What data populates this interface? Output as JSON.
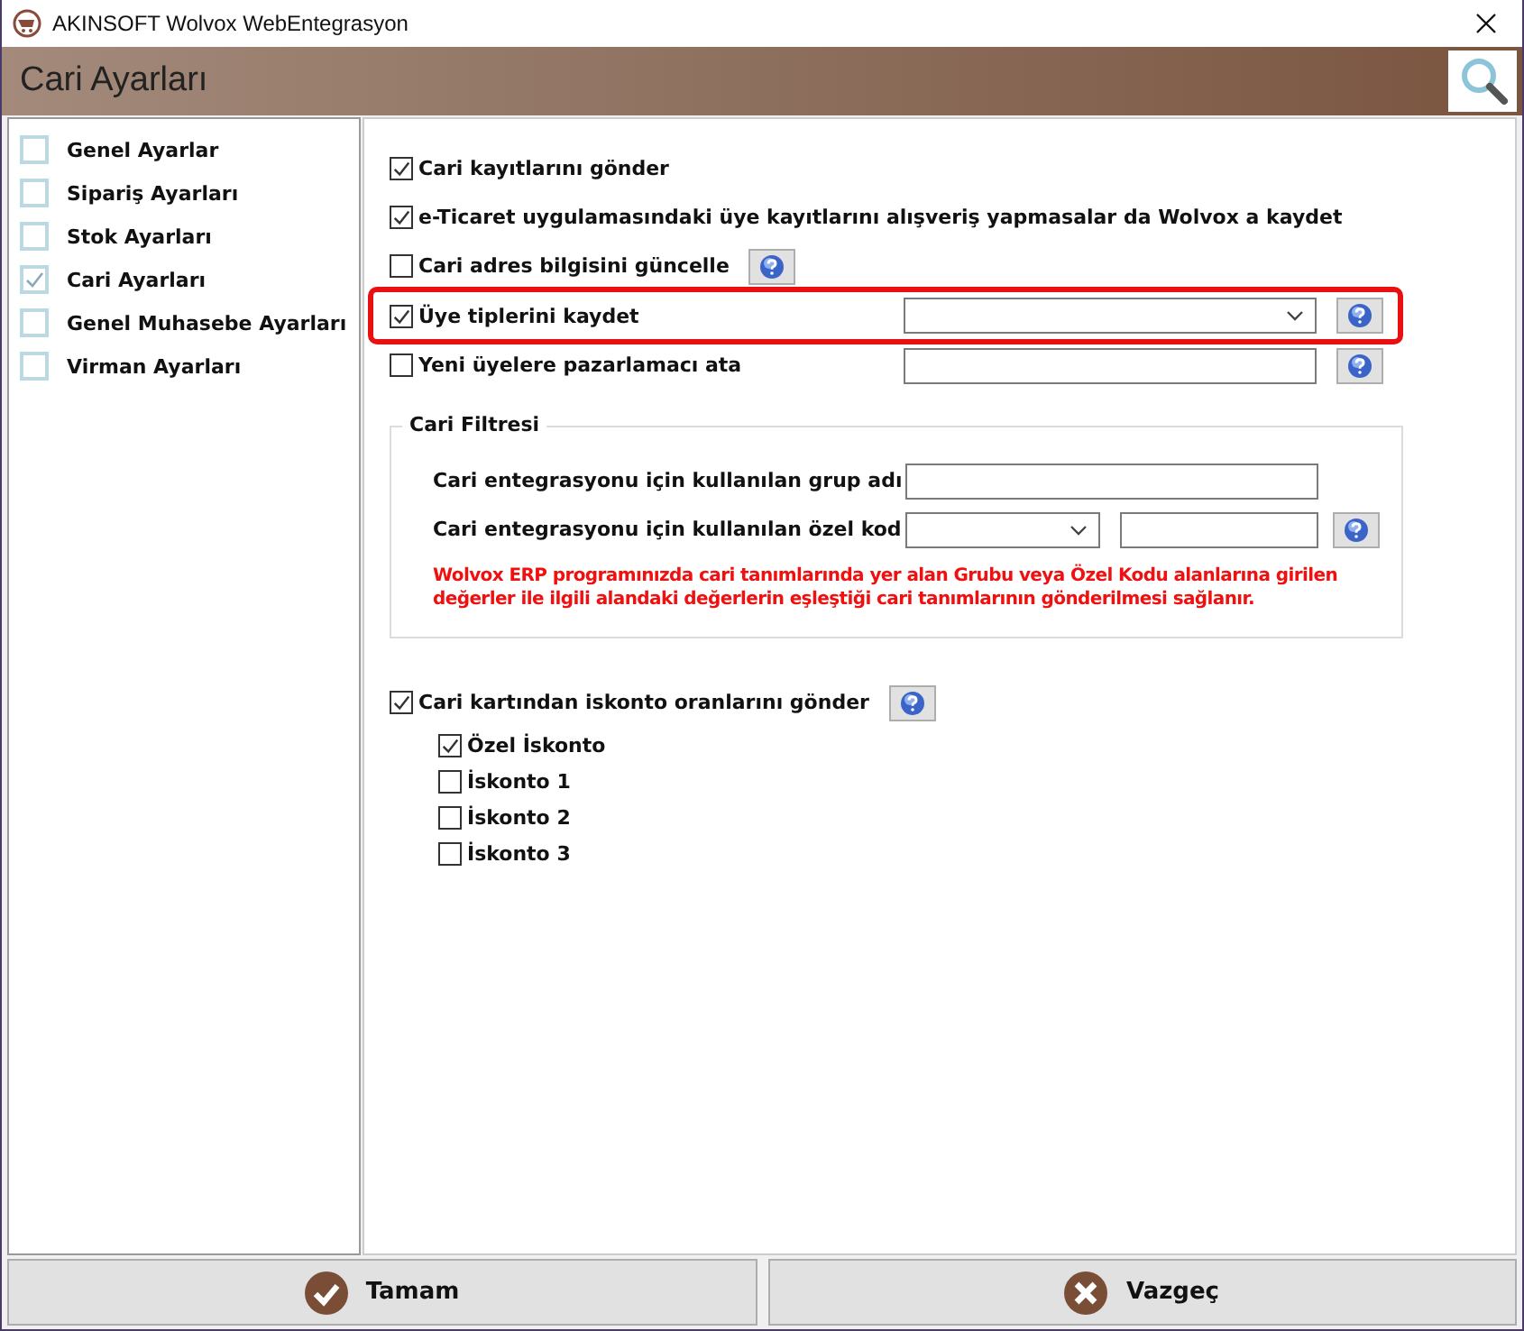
{
  "window": {
    "title": "AKINSOFT Wolvox WebEntegrasyon"
  },
  "header": {
    "title": "Cari Ayarları"
  },
  "sidebar": {
    "items": [
      {
        "label": "Genel Ayarlar",
        "checked": false
      },
      {
        "label": "Sipariş Ayarları",
        "checked": false
      },
      {
        "label": "Stok Ayarları",
        "checked": false
      },
      {
        "label": "Cari Ayarları",
        "checked": true
      },
      {
        "label": "Genel Muhasebe Ayarları",
        "checked": false
      },
      {
        "label": "Virman Ayarları",
        "checked": false
      }
    ]
  },
  "options": [
    {
      "kind": "plain",
      "label": "Cari kayıtlarını gönder",
      "checked": true,
      "highlighted": false
    },
    {
      "kind": "plain",
      "label": "e-Ticaret uygulamasındaki üye kayıtlarını alışveriş yapmasalar da Wolvox a kaydet",
      "checked": true,
      "highlighted": false
    },
    {
      "kind": "help",
      "label": "Cari adres bilgisini güncelle",
      "checked": false,
      "highlighted": false
    },
    {
      "kind": "select",
      "label": "Üye tiplerini kaydet",
      "checked": true,
      "highlighted": true
    },
    {
      "kind": "input",
      "label": "Yeni üyelere pazarlamacı ata",
      "checked": false,
      "highlighted": false
    }
  ],
  "filter": {
    "title": "Cari Filtresi",
    "rows": [
      {
        "kind": "input",
        "label": "Cari entegrasyonu için kullanılan grup adı"
      },
      {
        "kind": "select_input",
        "label": "Cari entegrasyonu için kullanılan özel kod"
      }
    ],
    "note": "Wolvox ERP programınızda cari tanımlarında yer alan Grubu veya Özel Kodu alanlarına girilen değerler ile ilgili alandaki değerlerin eşleştiği cari tanımlarının gönderilmesi sağlanır."
  },
  "discount": {
    "label": "Cari kartından iskonto oranlarını gönder",
    "checked": true,
    "items": [
      {
        "label": "Özel İskonto",
        "checked": true
      },
      {
        "label": "İskonto 1",
        "checked": false
      },
      {
        "label": "İskonto 2",
        "checked": false
      },
      {
        "label": "İskonto 3",
        "checked": false
      }
    ]
  },
  "buttons": [
    {
      "kind": "ok",
      "label": "Tamam"
    },
    {
      "kind": "cancel",
      "label": "Vazgeç"
    }
  ]
}
